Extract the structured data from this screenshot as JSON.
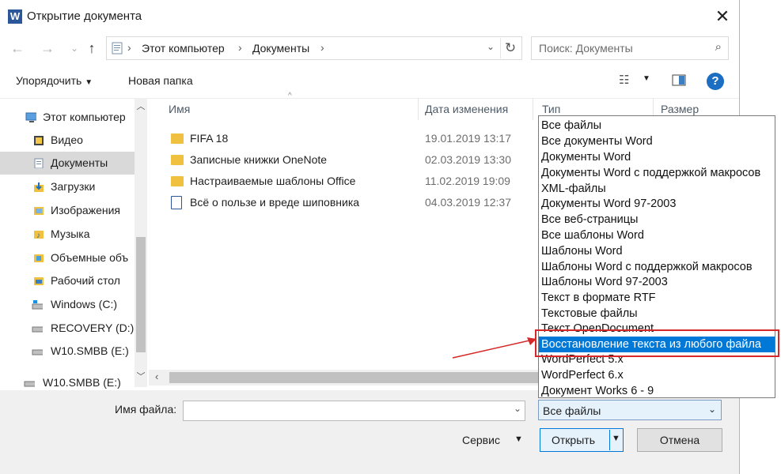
{
  "window": {
    "title": "Открытие документа",
    "app_icon": "W"
  },
  "address": {
    "segments": [
      "Этот компьютер",
      "Документы"
    ]
  },
  "search": {
    "placeholder": "Поиск: Документы"
  },
  "toolbar": {
    "organize": "Упорядочить",
    "new_folder": "Новая папка"
  },
  "nav": {
    "items": [
      {
        "label": "Этот компьютер",
        "icon": "computer-icon"
      },
      {
        "label": "Видео",
        "icon": "video-folder-icon"
      },
      {
        "label": "Документы",
        "icon": "documents-folder-icon"
      },
      {
        "label": "Загрузки",
        "icon": "downloads-folder-icon"
      },
      {
        "label": "Изображения",
        "icon": "pictures-folder-icon"
      },
      {
        "label": "Музыка",
        "icon": "music-folder-icon"
      },
      {
        "label": "Объемные объ",
        "icon": "3d-objects-folder-icon"
      },
      {
        "label": "Рабочий стол",
        "icon": "desktop-folder-icon"
      },
      {
        "label": "Windows (C:)",
        "icon": "drive-icon"
      },
      {
        "label": "RECOVERY (D:)",
        "icon": "drive-icon"
      },
      {
        "label": "W10.SMBB (E:)",
        "icon": "drive-icon"
      },
      {
        "label": "W10.SMBB (E:)",
        "icon": "drive-icon"
      }
    ]
  },
  "columns": {
    "name": "Имя",
    "date": "Дата изменения",
    "type": "Тип",
    "size": "Размер"
  },
  "files": [
    {
      "name": "FIFA 18",
      "date": "19.01.2019 13:17",
      "kind": "folder"
    },
    {
      "name": "Записные книжки OneNote",
      "date": "02.03.2019 13:30",
      "kind": "folder"
    },
    {
      "name": "Настраиваемые шаблоны Office",
      "date": "11.02.2019 19:09",
      "kind": "folder"
    },
    {
      "name": "Всё о пользе и вреде шиповника",
      "date": "04.03.2019 12:37",
      "kind": "doc"
    }
  ],
  "footer": {
    "filename_label": "Имя файла:",
    "filename_value": "",
    "filetype_selected": "Все файлы",
    "service": "Сервис",
    "open": "Открыть",
    "cancel": "Отмена"
  },
  "filetype_options": [
    "Все файлы",
    "Все документы Word",
    "Документы Word",
    "Документы Word с поддержкой макросов",
    "XML-файлы",
    "Документы Word 97-2003",
    "Все веб-страницы",
    "Все шаблоны Word",
    "Шаблоны Word",
    "Шаблоны Word с поддержкой макросов",
    "Шаблоны Word 97-2003",
    "Текст в формате RTF",
    "Текстовые файлы",
    "Текст OpenDocument",
    "Восстановление текста из любого файла",
    "WordPerfect 5.x",
    "WordPerfect 6.x",
    "Документ Works 6 - 9"
  ],
  "highlighted_option_index": 14,
  "colors": {
    "accent": "#0078d7",
    "annotation": "#d62828",
    "selected_nav": "#d9d9d9"
  }
}
